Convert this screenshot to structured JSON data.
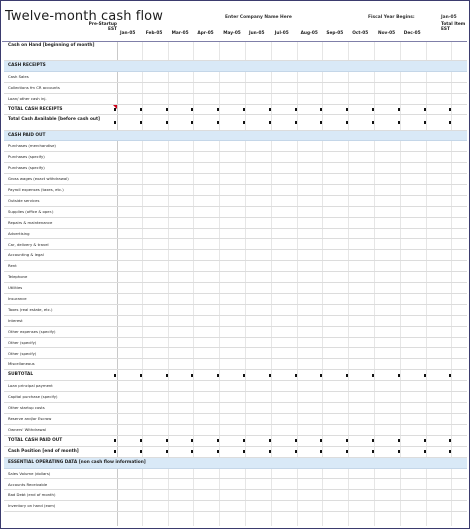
{
  "header": {
    "title": "Twelve-month cash flow",
    "company": "Enter Company Name Here",
    "fiscal_label": "Fiscal Year Begins:",
    "fiscal_value": "Jan-05",
    "pre_startup": "Pre-Startup EST",
    "total_label": "Total Item EST"
  },
  "months": [
    "Jan-05",
    "Feb-05",
    "Mar-05",
    "Apr-05",
    "May-05",
    "Jun-05",
    "Jul-05",
    "Aug-05",
    "Sep-05",
    "Oct-05",
    "Nov-05",
    "Dec-05"
  ],
  "rows": [
    {
      "label": "Cash on Hand [beginning of month]",
      "type": "bold",
      "h": 19
    },
    {
      "label": "CASH RECEIPTS",
      "type": "sec"
    },
    {
      "label": "Cash Sales"
    },
    {
      "label": "Collections fm CR accounts"
    },
    {
      "label": "Loan/ other cash inj."
    },
    {
      "label": "TOTAL CASH RECEIPTS",
      "type": "bold",
      "marks": true,
      "flag": true
    },
    {
      "label": "Total Cash Available [before cash out]",
      "type": "bold",
      "marks": true,
      "h": 15
    },
    {
      "label": "CASH PAID OUT",
      "type": "sec"
    },
    {
      "label": "Purchases (merchandise)"
    },
    {
      "label": "Purchases (specify)"
    },
    {
      "label": "Purchases (specify)"
    },
    {
      "label": "Gross wages (exact withdrawal)"
    },
    {
      "label": "Payroll expenses (taxes, etc.)"
    },
    {
      "label": "Outside services"
    },
    {
      "label": "Supplies (office & oper.)"
    },
    {
      "label": "Repairs & maintenance"
    },
    {
      "label": "Advertising"
    },
    {
      "label": "Car, delivery & travel"
    },
    {
      "label": "Accounting & legal"
    },
    {
      "label": "Rent"
    },
    {
      "label": "Telephone"
    },
    {
      "label": "Utilities"
    },
    {
      "label": "Insurance"
    },
    {
      "label": "Taxes (real estate, etc.)"
    },
    {
      "label": "Interest"
    },
    {
      "label": "Other expenses (specify)"
    },
    {
      "label": "Other (specify)"
    },
    {
      "label": "Other (specify)"
    },
    {
      "label": "Miscellaneous"
    },
    {
      "label": "SUBTOTAL",
      "type": "bold",
      "marks": true
    },
    {
      "label": "Loan principal payment"
    },
    {
      "label": "Capital purchase (specify)"
    },
    {
      "label": "Other startup costs"
    },
    {
      "label": "Reserve and/or Escrow"
    },
    {
      "label": "Owners' Withdrawal"
    },
    {
      "label": "TOTAL CASH PAID OUT",
      "type": "bold",
      "marks": true
    },
    {
      "label": "Cash Position [end of month]",
      "type": "bold",
      "marks": true,
      "h": 11
    },
    {
      "label": "ESSENTIAL OPERATING DATA [non cash flow information]",
      "type": "sec",
      "h": 11
    },
    {
      "label": "Sales Volume (dollars)"
    },
    {
      "label": "Accounts Receivable"
    },
    {
      "label": "Bad Debt (end of month)"
    },
    {
      "label": "Inventory on hand (eom)"
    }
  ]
}
